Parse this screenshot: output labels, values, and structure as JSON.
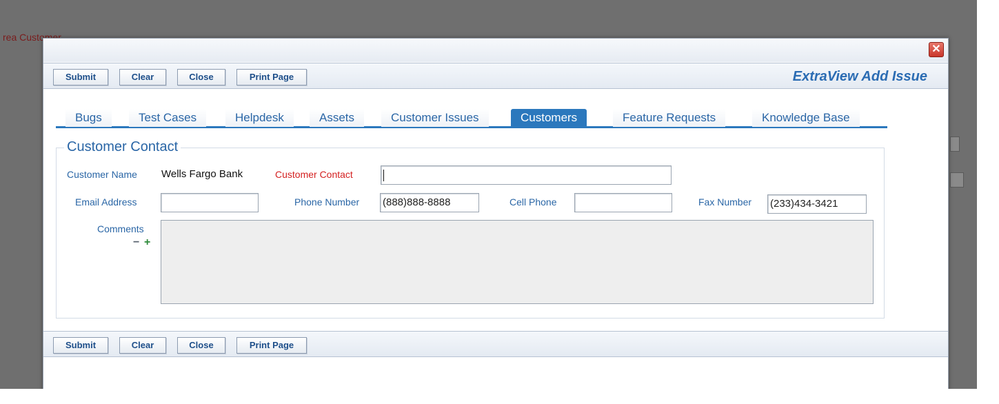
{
  "background": {
    "partial_text": "rea Customer"
  },
  "dialog": {
    "title": "ExtraView Add Issue",
    "close_glyph": "✕"
  },
  "toolbar": {
    "submit_label": "Submit",
    "clear_label": "Clear",
    "close_label": "Close",
    "print_label": "Print Page"
  },
  "tabs": [
    {
      "label": "Bugs",
      "active": false
    },
    {
      "label": "Test Cases",
      "active": false
    },
    {
      "label": "Helpdesk",
      "active": false
    },
    {
      "label": "Assets",
      "active": false
    },
    {
      "label": "Customer Issues",
      "active": false
    },
    {
      "label": "Customers",
      "active": true
    },
    {
      "label": "Feature Requests",
      "active": false
    },
    {
      "label": "Knowledge Base",
      "active": false
    }
  ],
  "section": {
    "title": "Customer Contact",
    "customer_name_label": "Customer Name",
    "customer_name_value": "Wells Fargo Bank",
    "customer_contact_label": "Customer Contact",
    "customer_contact_value": "",
    "email_label": "Email Address",
    "email_value": "",
    "phone_label": "Phone Number",
    "phone_value": "(888)888-8888",
    "cell_label": "Cell Phone",
    "cell_value": "",
    "fax_label": "Fax Number",
    "fax_value": "(233)434-3421",
    "comments_label": "Comments",
    "comments_value": "",
    "collapse_glyph": "−",
    "expand_glyph": "+"
  },
  "colors": {
    "accent": "#2b78bd",
    "link_blue": "#2a66a6",
    "required_red": "#d42020",
    "collapse_icon": "#5a6470",
    "expand_icon": "#2e8b3a"
  },
  "icons": {
    "close": "close-icon",
    "collapse": "minus-icon",
    "expand": "plus-icon"
  }
}
